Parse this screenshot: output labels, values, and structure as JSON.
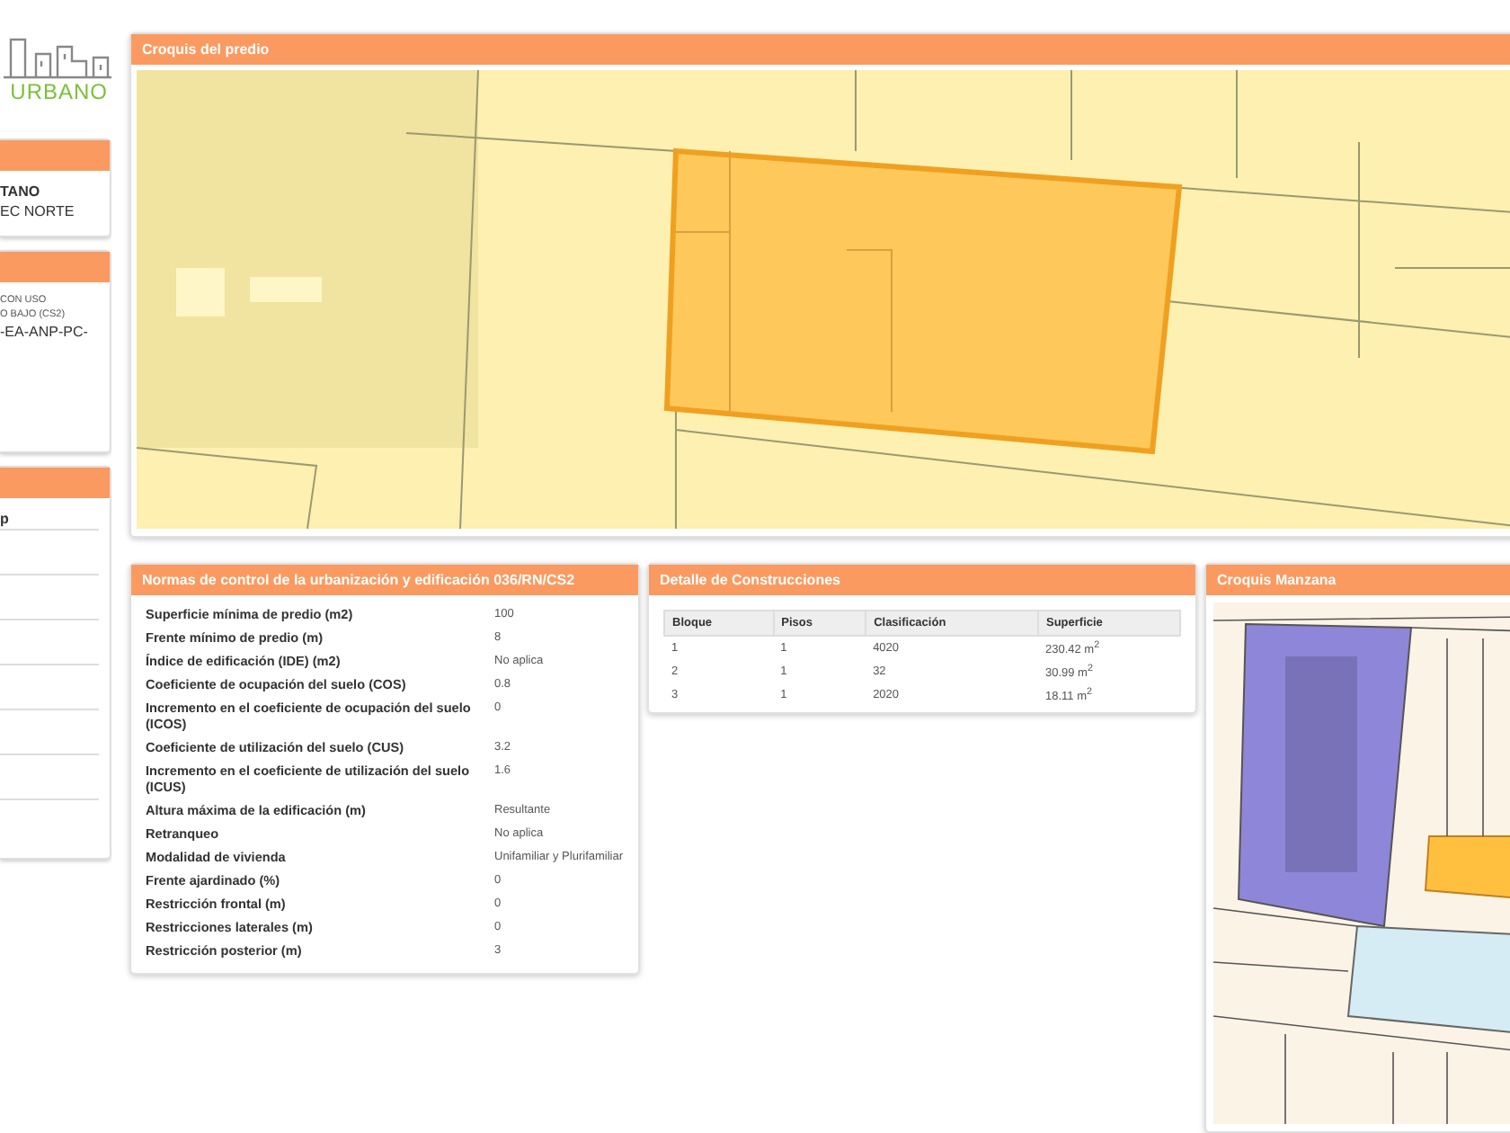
{
  "sidebar": {
    "logo_text": "URBANO",
    "panels": [
      {
        "lines": [
          {
            "text": "TANO",
            "kind": "strong"
          },
          {
            "text": "EC NORTE",
            "kind": "plain"
          }
        ]
      },
      {
        "lines": [
          {
            "text": "CON USO",
            "kind": "small"
          },
          {
            "text": "O BAJO (CS2)",
            "kind": "small"
          },
          {
            "text": "-EA-ANP-PC-",
            "kind": "plain"
          }
        ]
      },
      {
        "lines": [
          {
            "text": "p",
            "kind": "strong"
          }
        ]
      }
    ]
  },
  "predio": {
    "title": "Croquis del predio"
  },
  "normas": {
    "title": "Normas de control de la urbanización y edificación 036/RN/CS2",
    "rows": [
      {
        "label": "Superficie mínima de predio (m2)",
        "value": "100"
      },
      {
        "label": "Frente mínimo de predio (m)",
        "value": "8"
      },
      {
        "label": "Índice de edificación (IDE) (m2)",
        "value": "No aplica"
      },
      {
        "label": "Coeficiente de ocupación del suelo (COS)",
        "value": "0.8"
      },
      {
        "label": "Incremento en el coeficiente de ocupación del suelo (ICOS)",
        "value": "0"
      },
      {
        "label": "Coeficiente de utilización del suelo (CUS)",
        "value": "3.2"
      },
      {
        "label": "Incremento en el coeficiente de utilización del suelo (ICUS)",
        "value": "1.6"
      },
      {
        "label": "Altura máxima de la edificación (m)",
        "value": "Resultante"
      },
      {
        "label": "Retranqueo",
        "value": "No aplica"
      },
      {
        "label": "Modalidad de vivienda",
        "value": "Unifamiliar y Plurifamiliar"
      },
      {
        "label": "Frente ajardinado (%)",
        "value": "0"
      },
      {
        "label": "Restricción frontal (m)",
        "value": "0"
      },
      {
        "label": "Restricciones laterales (m)",
        "value": "0"
      },
      {
        "label": "Restricción posterior (m)",
        "value": "3"
      }
    ]
  },
  "construcciones": {
    "title": "Detalle de Construcciones",
    "columns": [
      "Bloque",
      "Pisos",
      "Clasificación",
      "Superficie"
    ],
    "rows": [
      [
        "1",
        "1",
        "4020",
        "230.42 m$^{2}$"
      ],
      [
        "2",
        "1",
        "32",
        "30.99 m$^{2}$"
      ],
      [
        "3",
        "1",
        "2020",
        "18.11 m$^{2}$"
      ]
    ]
  },
  "manzana": {
    "title": "Croquis Manzana"
  }
}
